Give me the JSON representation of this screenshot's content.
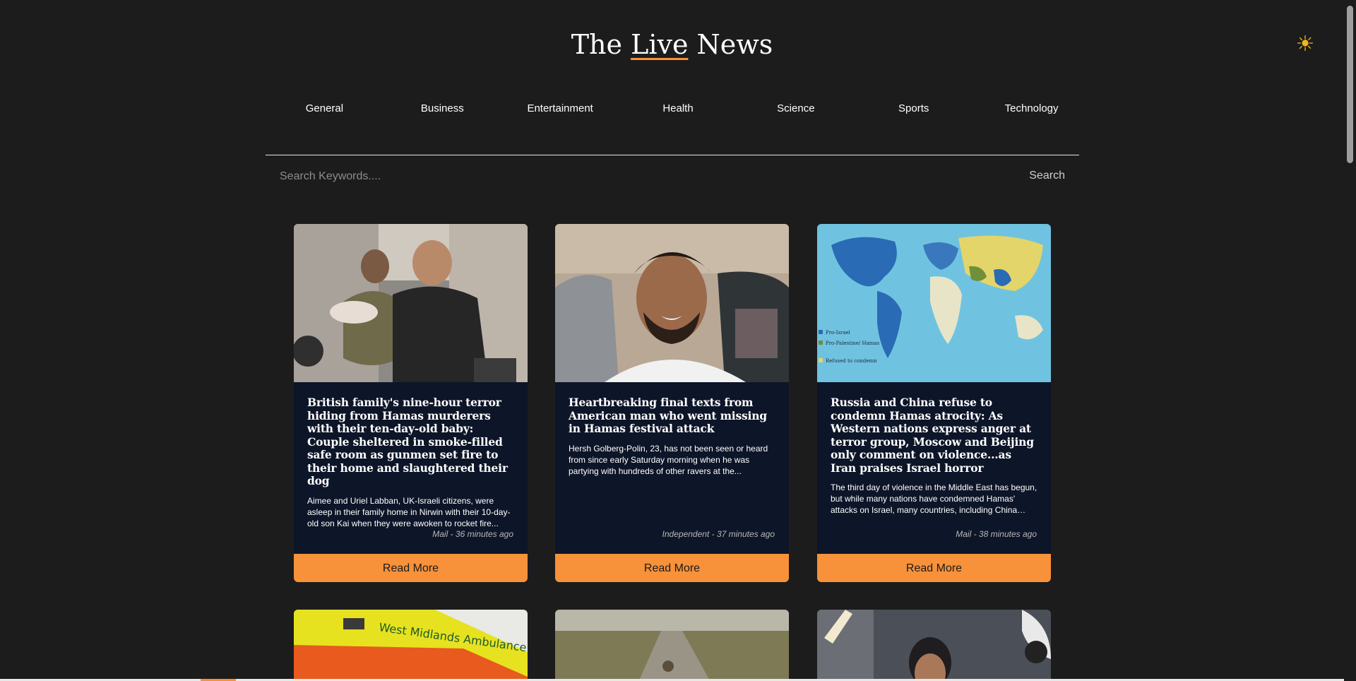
{
  "header": {
    "title_prefix": "The ",
    "title_accent": "Live",
    "title_suffix": " News",
    "theme_toggle_icon": "sun-icon",
    "theme_toggle_glyph": "☀",
    "accent_color": "#f7913a"
  },
  "nav": {
    "items": [
      {
        "label": "General"
      },
      {
        "label": "Business"
      },
      {
        "label": "Entertainment"
      },
      {
        "label": "Health"
      },
      {
        "label": "Science"
      },
      {
        "label": "Sports"
      },
      {
        "label": "Technology"
      }
    ]
  },
  "search": {
    "placeholder": "Search Keywords....",
    "value": "",
    "button_label": "Search"
  },
  "articles": [
    {
      "title": "British family's nine-hour terror hiding from Hamas murderers with their ten-day-old baby: Couple sheltered in smoke-filled safe room as gunmen set fire to their home and slaughtered their dog",
      "description": "Aimee and Uriel Labban, UK-Israeli citizens, were asleep in their family home in Nirwin with their 10-day-old son Kai when they were awoken to rocket fire...",
      "meta": "Mail - 36 minutes ago",
      "read_more": "Read More",
      "image": "photo of a family with a newborn baby"
    },
    {
      "title": "Heartbreaking final texts from American man who went missing in Hamas festival attack",
      "description": "Hersh Golberg-Polin, 23, has not been seen or heard from since early Saturday morning when he was partying with hundreds of other ravers at the...",
      "meta": "Independent - 37 minutes ago",
      "read_more": "Read More",
      "image": "portrait of a smiling young man in a car"
    },
    {
      "title": "Russia and China refuse to condemn Hamas atrocity: As Western nations express anger at terror group, Moscow and Beijing only comment on violence...as Iran praises Israel horror",
      "description": "The third day of violence in the Middle East has begun, but while many nations have condemned Hamas' attacks on Israel, many countries, including China and...",
      "meta": "Mail - 38 minutes ago",
      "read_more": "Read More",
      "image": "world map",
      "map_legend": [
        "Pro-Israel",
        "Pro-Palestine/ Hamas",
        "Refused to condemn"
      ]
    },
    {
      "image": "ambulance photo",
      "image_text": "West Midlands Ambulance Service EMERGENCY"
    },
    {
      "image": "dirt road landscape photo"
    },
    {
      "image": "cricket player photo"
    }
  ]
}
